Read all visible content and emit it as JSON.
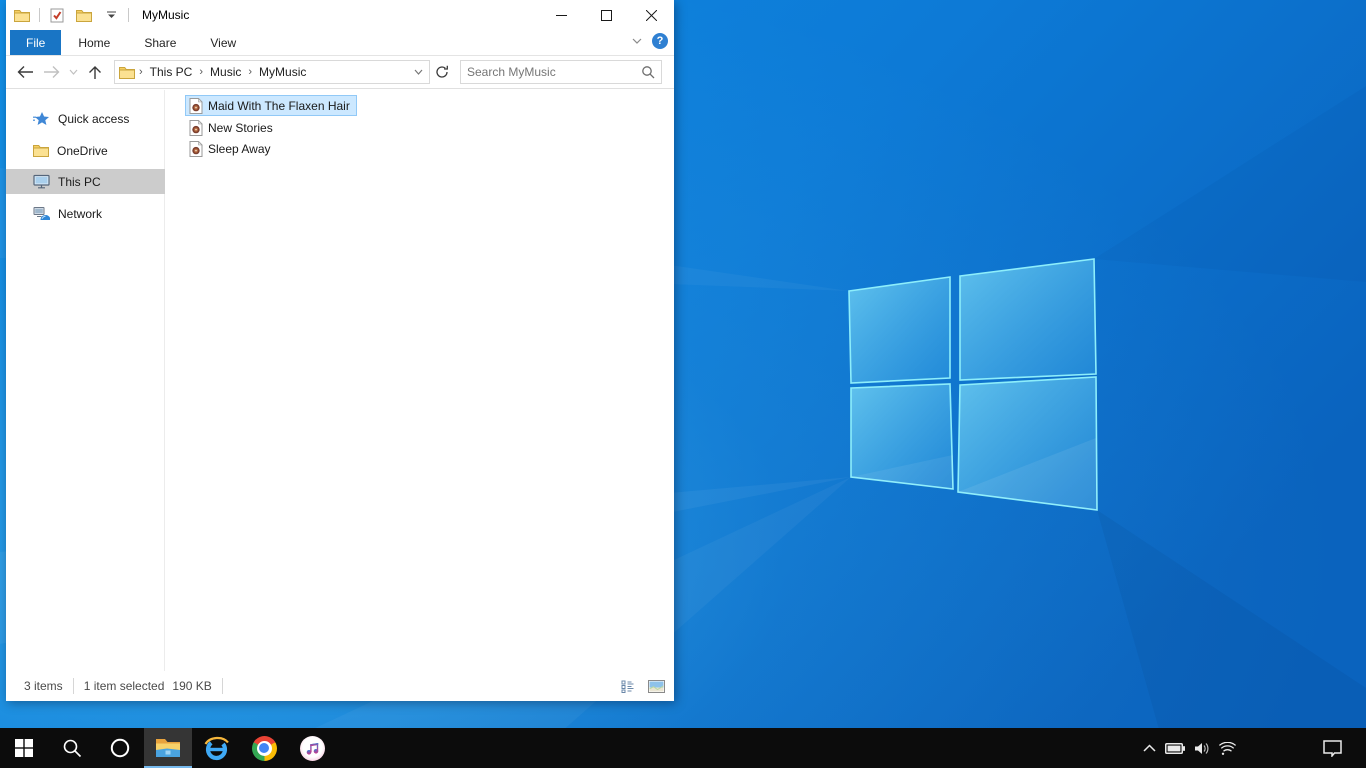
{
  "colors": {
    "accent": "#1975c5",
    "file_selection_bg": "#cce8ff",
    "file_selection_border": "#91c9f7",
    "sidebar_selection_bg": "#cccccc",
    "taskbar_bg": "#0c0c0c",
    "taskbar_active_underline": "#76b9ed",
    "wallpaper_base": "#0d7ad6"
  },
  "window": {
    "title": "MyMusic",
    "quick_access_toolbar": {
      "icons": [
        "explorer-folder-icon",
        "properties-icon",
        "new-folder-icon",
        "customize-quick-access-chevron"
      ]
    },
    "window_controls": [
      "minimize",
      "maximize",
      "close"
    ],
    "ribbon": {
      "tabs": [
        {
          "label": "File",
          "active": true
        },
        {
          "label": "Home",
          "active": false
        },
        {
          "label": "Share",
          "active": false
        },
        {
          "label": "View",
          "active": false
        }
      ],
      "help_label": "?"
    },
    "navigation": {
      "breadcrumb": [
        "This PC",
        "Music",
        "MyMusic"
      ],
      "separator": "›"
    },
    "search": {
      "placeholder": "Search MyMusic"
    },
    "sidebar": {
      "items": [
        {
          "label": "Quick access",
          "icon": "quick-access-star-icon",
          "selected": false
        },
        {
          "label": "OneDrive",
          "icon": "onedrive-folder-icon",
          "selected": false
        },
        {
          "label": "This PC",
          "icon": "this-pc-icon",
          "selected": true
        },
        {
          "label": "Network",
          "icon": "network-icon",
          "selected": false
        }
      ]
    },
    "files": [
      {
        "name": "Maid With The Flaxen Hair",
        "icon": "audio-file-icon",
        "selected": true
      },
      {
        "name": "New Stories",
        "icon": "audio-file-icon",
        "selected": false
      },
      {
        "name": "Sleep Away",
        "icon": "audio-file-icon",
        "selected": false
      }
    ],
    "status_bar": {
      "items_count": "3 items",
      "selected_count": "1 item selected",
      "selected_size": "190 KB",
      "view_buttons": [
        "details-view",
        "large-thumbnails-view"
      ]
    }
  },
  "taskbar": {
    "buttons": [
      {
        "name": "start",
        "active": false
      },
      {
        "name": "search",
        "active": false
      },
      {
        "name": "cortana",
        "active": false
      },
      {
        "name": "file-explorer",
        "active": true
      },
      {
        "name": "internet-explorer",
        "active": false
      },
      {
        "name": "chrome",
        "active": false
      },
      {
        "name": "itunes",
        "active": false
      }
    ],
    "tray_icons": [
      "hidden-icons-chevron",
      "battery",
      "volume",
      "wifi",
      "action-center"
    ]
  }
}
